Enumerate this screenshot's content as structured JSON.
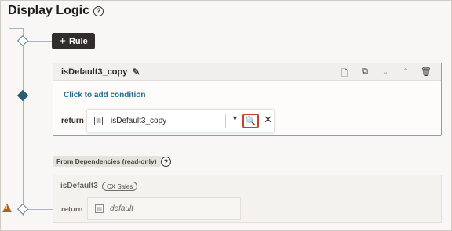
{
  "page": {
    "title": "Display Logic",
    "help_icon": "question-circle-icon"
  },
  "toolbar": {
    "rule_button_label": "Rule",
    "rule_button_icon": "plus-icon"
  },
  "rule_card": {
    "name": "isDefault3_copy",
    "edit_icon": "pencil-icon",
    "actions": [
      "document-icon",
      "copy-icon",
      "chevron-down-icon",
      "chevron-up-icon",
      "trash-icon"
    ],
    "add_condition_label": "Click to add condition",
    "return_label": "return",
    "expression_value": "isDefault3_copy",
    "expression_field_icon": "field-icon",
    "dropdown_icon": "caret-down-icon",
    "lookup_icon": "document-search-icon",
    "clear_icon": "close-icon"
  },
  "dependencies": {
    "badge_label": "From Dependencies (read-only)",
    "help_icon": "question-circle-icon",
    "item_name": "isDefault3",
    "item_tag": "CX Sales",
    "return_label": "return",
    "return_value": "default",
    "warning_icon": "warning-triangle-icon"
  },
  "colors": {
    "connector": "#9fb7c7",
    "accent_link": "#226b8e",
    "rule_button_bg": "#312d2a",
    "highlight": "#c7402d",
    "warning": "#b0620f"
  }
}
